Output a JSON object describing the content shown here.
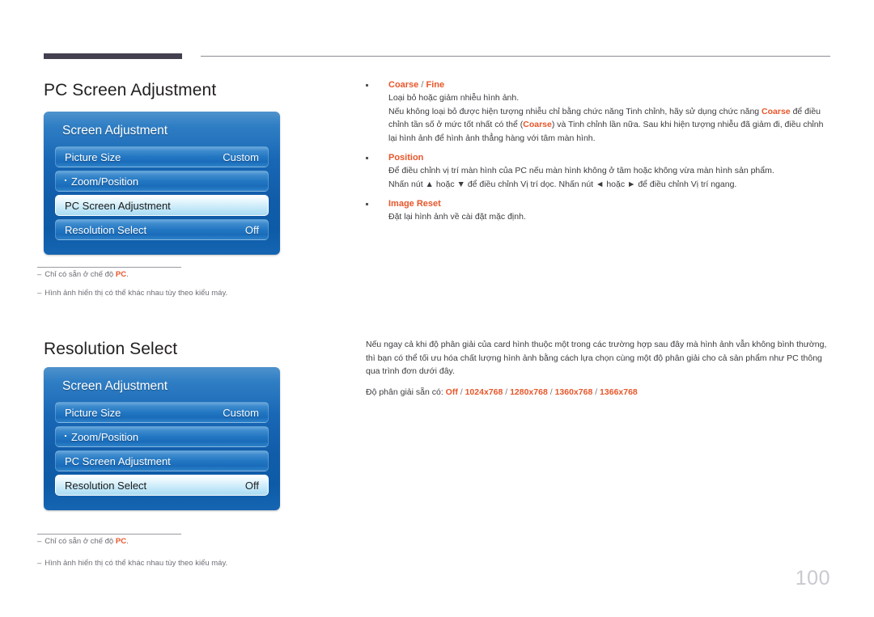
{
  "header": {
    "rule_accent_color": "#444050",
    "rule_line_color": "#8d8d96"
  },
  "sections": [
    {
      "title": "PC Screen Adjustment",
      "osd": {
        "title": "Screen Adjustment",
        "rows": [
          {
            "label": "Picture Size",
            "value": "Custom",
            "selected": false,
            "bullet": false
          },
          {
            "label": "Zoom/Position",
            "value": "",
            "selected": false,
            "bullet": true
          },
          {
            "label": "PC Screen Adjustment",
            "value": "",
            "selected": true,
            "bullet": false
          },
          {
            "label": "Resolution Select",
            "value": "Off",
            "selected": false,
            "bullet": false
          }
        ]
      },
      "footnotes": [
        {
          "dash": "–",
          "pre": "Chỉ có sẵn ở chế độ ",
          "hl": "PC",
          "post": "."
        },
        {
          "dash": "–",
          "pre": "Hình ảnh hiển thị có thể khác nhau tùy theo kiểu máy.",
          "hl": "",
          "post": ""
        }
      ]
    },
    {
      "title": "Resolution Select",
      "osd": {
        "title": "Screen Adjustment",
        "rows": [
          {
            "label": "Picture Size",
            "value": "Custom",
            "selected": false,
            "bullet": false
          },
          {
            "label": "Zoom/Position",
            "value": "",
            "selected": false,
            "bullet": true
          },
          {
            "label": "PC Screen Adjustment",
            "value": "",
            "selected": false,
            "bullet": false
          },
          {
            "label": "Resolution Select",
            "value": "Off",
            "selected": true,
            "bullet": false
          }
        ]
      },
      "footnotes": [
        {
          "dash": "–",
          "pre": "Chỉ có sẵn ở chế độ ",
          "hl": "PC",
          "post": "."
        },
        {
          "dash": "–",
          "pre": "Hình ảnh hiển thị có thể khác nhau tùy theo kiểu máy.",
          "hl": "",
          "post": ""
        }
      ]
    }
  ],
  "right_column_1": {
    "items": [
      {
        "head_a": "Coarse",
        "head_sep": " / ",
        "head_b": "Fine",
        "para1": "Loại bỏ hoặc giảm nhiễu hình ảnh.",
        "para2_a": "Nếu không loại bỏ được hiện tượng nhiễu chỉ bằng chức năng Tinh chỉnh, hãy sử dụng chức năng ",
        "para2_hl1": "Coarse",
        "para2_b": " để điều chỉnh tần số ở mức tốt nhất có thể (",
        "para2_hl2": "Coarse",
        "para2_c": ") và Tinh chỉnh lần nữa. Sau khi hiện tượng nhiễu đã giảm đi, điều chỉnh lại hình ảnh để hình ảnh thẳng hàng với tâm màn hình."
      },
      {
        "head_a": "Position",
        "para1": "Để điều chỉnh vị trí màn hình của PC nếu màn hình không ở tâm hoặc không vừa màn hình sản phẩm.",
        "para2": "Nhấn nút ▲ hoặc ▼ để điều chỉnh Vị trí dọc. Nhấn nút ◄ hoặc ► để điều chỉnh Vị trí ngang."
      },
      {
        "head_a": "Image Reset",
        "para1": "Đặt lại hình ảnh về cài đặt mặc định."
      }
    ]
  },
  "right_column_2": {
    "paragraph": "Nếu ngay cả khi độ phân giải của card hình thuộc một trong các trường hợp sau đây mà hình ảnh vẫn không bình thường, thì bạn có thể tối ưu hóa chất lượng hình ảnh bằng cách lựa chọn cùng một độ phân giải cho cả sản phẩm như PC thông qua trình đơn dưới đây.",
    "res_label": "Độ phân giải sẵn có: ",
    "res_options": [
      "Off",
      "1024x768",
      "1280x768",
      "1360x768",
      "1366x768"
    ],
    "res_separator": " / "
  },
  "page_number": "100",
  "colors": {
    "accent_orange": "#e8562a",
    "osd_blue": "#1867b5",
    "osd_selected": "#d7f0fb",
    "page_number_gray": "#c9c9d0"
  }
}
